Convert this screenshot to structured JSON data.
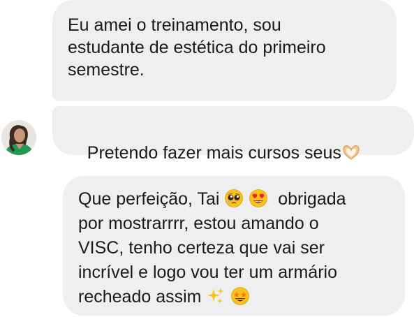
{
  "messages": [
    {
      "id": "msg-1",
      "text": "Eu amei o treinamento, sou\nestudante de estética do primeiro\nsemestre."
    },
    {
      "id": "msg-2",
      "text": "Pretendo fazer mais cursos seus",
      "trailing_emoji": "heart-hands-emoji"
    },
    {
      "id": "msg-3",
      "line1": "Que perfeição, Tai ",
      "line1_after_emojis": "  obrigada",
      "rest": "por mostrarrrr, estou amando o\nVISC, tenho certeza que vai ser\nincrível e logo vou ter um armário\nrecheado assim ",
      "emojis": [
        "pleading-face-emoji",
        "heart-eyes-emoji",
        "sparkles-emoji",
        "star-struck-emoji"
      ]
    }
  ],
  "colors": {
    "bubble": "#efeff1",
    "text": "#1a1a1a"
  }
}
